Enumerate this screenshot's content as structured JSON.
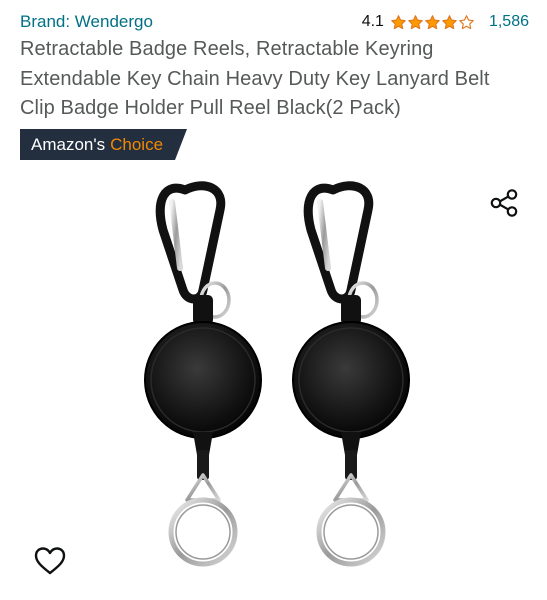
{
  "brand": {
    "label": "Brand: Wendergo"
  },
  "rating": {
    "value": "4.1",
    "stars": 4.1,
    "star_count": 5,
    "review_count": "1,586"
  },
  "product": {
    "title": "Retractable Badge Reels, Retractable Keyring Extendable Key Chain Heavy Duty Key Lanyard Belt Clip Badge Holder Pull Reel Black(2 Pack)"
  },
  "badge": {
    "prefix": "Amazon's",
    "highlight": "Choice"
  },
  "icons": {
    "share": "share-icon",
    "wishlist": "heart-icon",
    "star": "star-icon"
  },
  "colors": {
    "link": "#007185",
    "title": "#565959",
    "badge_bg": "#232f3e",
    "badge_highlight": "#f08804",
    "star": "#ff9900"
  }
}
